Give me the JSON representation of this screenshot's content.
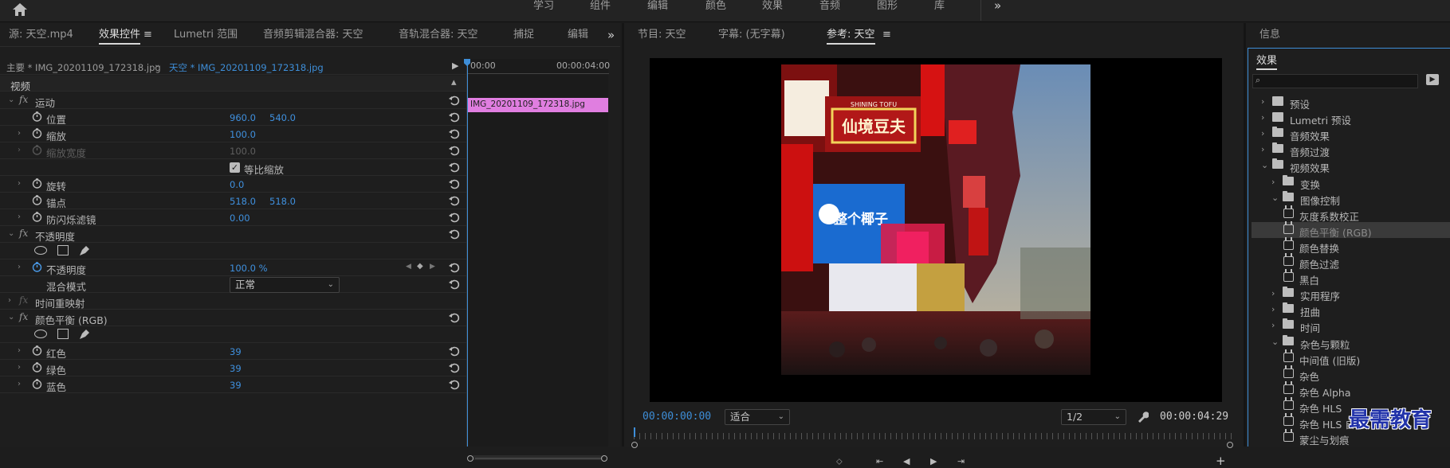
{
  "workspaces": [
    "学习",
    "组件",
    "编辑",
    "颜色",
    "效果",
    "音频",
    "图形",
    "库"
  ],
  "left_tabs": [
    "源: 天空.mp4",
    "效果控件",
    "Lumetri 范围",
    "音频剪辑混合器: 天空",
    "音轨混合器: 天空",
    "捕捉",
    "编辑"
  ],
  "ec": {
    "master_clip": "主要 * IMG_20201109_172318.jpg",
    "seq_clip": "天空 * IMG_20201109_172318.jpg",
    "tc_start": "00:00",
    "tc_end": "00:00:04:00",
    "clip_bar": "IMG_20201109_172318.jpg",
    "section": "视频",
    "motion": "运动",
    "position": "位置",
    "pos_x": "960.0",
    "pos_y": "540.0",
    "scale": "缩放",
    "scale_v": "100.0",
    "scale_w": "缩放宽度",
    "scale_w_v": "100.0",
    "uniform": "等比缩放",
    "rotation": "旋转",
    "rotation_v": "0.0",
    "anchor": "锚点",
    "anchor_x": "518.0",
    "anchor_y": "518.0",
    "flicker": "防闪烁滤镜",
    "flicker_v": "0.00",
    "opacity_group": "不透明度",
    "opacity": "不透明度",
    "opacity_v": "100.0 %",
    "blend": "混合模式",
    "blend_v": "正常",
    "time_remap": "时间重映射",
    "cb": "颜色平衡 (RGB)",
    "red": "红色",
    "red_v": "39",
    "green": "绿色",
    "green_v": "39",
    "blue": "蓝色",
    "blue_v": "39"
  },
  "program_tabs": [
    "节目: 天空",
    "字幕: (无字幕)",
    "参考: 天空"
  ],
  "program": {
    "timecode": "00:00:00:00",
    "fit": "适合",
    "resolution": "1/2",
    "duration": "00:00:04:29"
  },
  "photo_text": {
    "sign1": "SHINING TOFU",
    "sign2": "仙境豆夫",
    "sign3": "整个椰子"
  },
  "info_tab": "信息",
  "effects_tab": "效果",
  "effects_tree": [
    {
      "label": "预设",
      "icon": "preset"
    },
    {
      "label": "Lumetri 预设",
      "icon": "preset"
    },
    {
      "label": "音频效果",
      "icon": "folder"
    },
    {
      "label": "音频过渡",
      "icon": "folder"
    },
    {
      "label": "视频效果",
      "icon": "folder"
    },
    {
      "label": "变换",
      "icon": "folder"
    },
    {
      "label": "图像控制",
      "icon": "folder"
    },
    {
      "label": "灰度系数校正",
      "icon": "fx"
    },
    {
      "label": "颜色平衡 (RGB)",
      "icon": "fx"
    },
    {
      "label": "颜色替换",
      "icon": "fx"
    },
    {
      "label": "颜色过滤",
      "icon": "fx"
    },
    {
      "label": "黑白",
      "icon": "fx"
    },
    {
      "label": "实用程序",
      "icon": "folder"
    },
    {
      "label": "扭曲",
      "icon": "folder"
    },
    {
      "label": "时间",
      "icon": "folder"
    },
    {
      "label": "杂色与颗粒",
      "icon": "folder"
    },
    {
      "label": "中间值 (旧版)",
      "icon": "fx"
    },
    {
      "label": "杂色",
      "icon": "fx"
    },
    {
      "label": "杂色 Alpha",
      "icon": "fx"
    },
    {
      "label": "杂色 HLS",
      "icon": "fx"
    },
    {
      "label": "杂色 HLS 自动",
      "icon": "fx"
    },
    {
      "label": "蒙尘与划痕",
      "icon": "fx"
    }
  ],
  "watermark": "最需教育",
  "colors": {
    "accent": "#3e8ed8",
    "clip": "#e07ee0",
    "bg": "#1e1e1e"
  }
}
